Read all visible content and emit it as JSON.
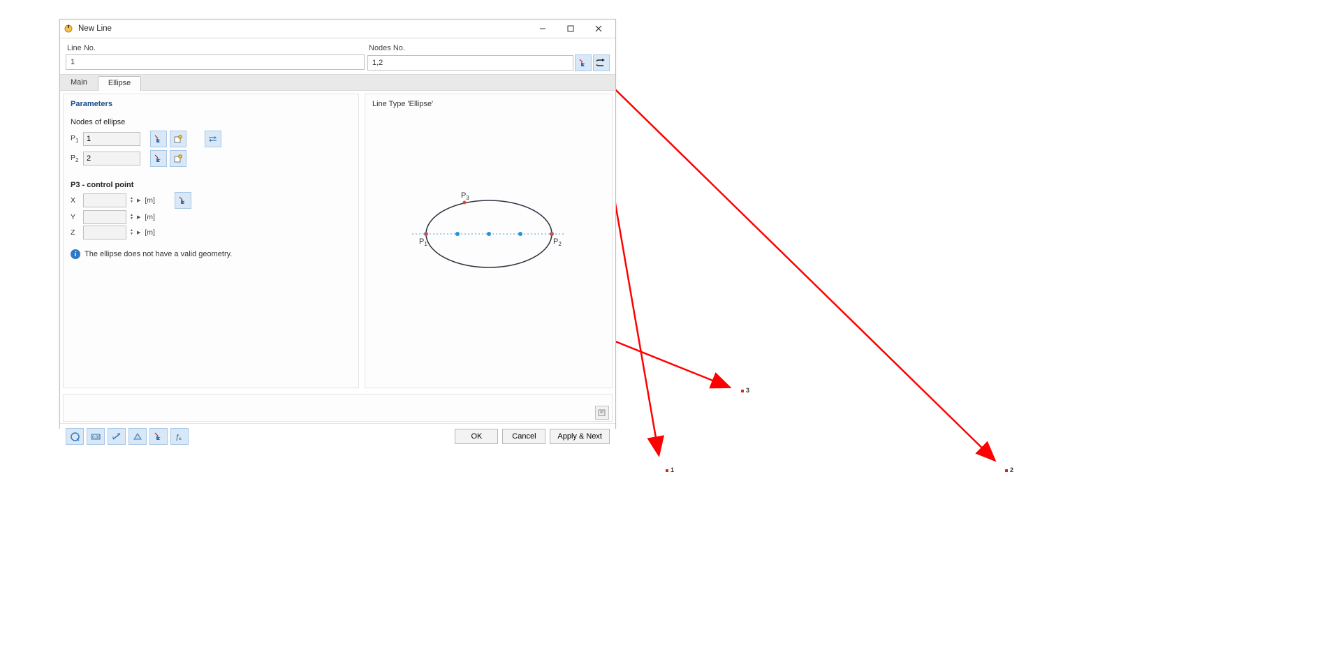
{
  "window": {
    "title": "New Line"
  },
  "top": {
    "line_no_label": "Line No.",
    "line_no_value": "1",
    "nodes_no_label": "Nodes No.",
    "nodes_no_value": "1,2"
  },
  "tabs": {
    "main": "Main",
    "ellipse": "Ellipse"
  },
  "parameters": {
    "section_title": "Parameters",
    "nodes_of_ellipse_label": "Nodes of ellipse",
    "p1_label_prefix": "P",
    "p1_label_sub": "1",
    "p1_value": "1",
    "p2_label_prefix": "P",
    "p2_label_sub": "2",
    "p2_value": "2",
    "p3_section": "P3 - control point",
    "x_label": "X",
    "y_label": "Y",
    "z_label": "Z",
    "x_value": "",
    "y_value": "",
    "z_value": "",
    "unit": "[m]",
    "validation_msg": "The ellipse does not have a valid geometry."
  },
  "preview": {
    "title": "Line Type 'Ellipse'",
    "p1": "P",
    "p1s": "1",
    "p2": "P",
    "p2s": "2",
    "p3": "P",
    "p3s": "3"
  },
  "footer": {
    "ok": "OK",
    "cancel": "Cancel",
    "apply_next": "Apply & Next"
  },
  "ext_points": {
    "n1": "1",
    "n2": "2",
    "n3": "3"
  }
}
